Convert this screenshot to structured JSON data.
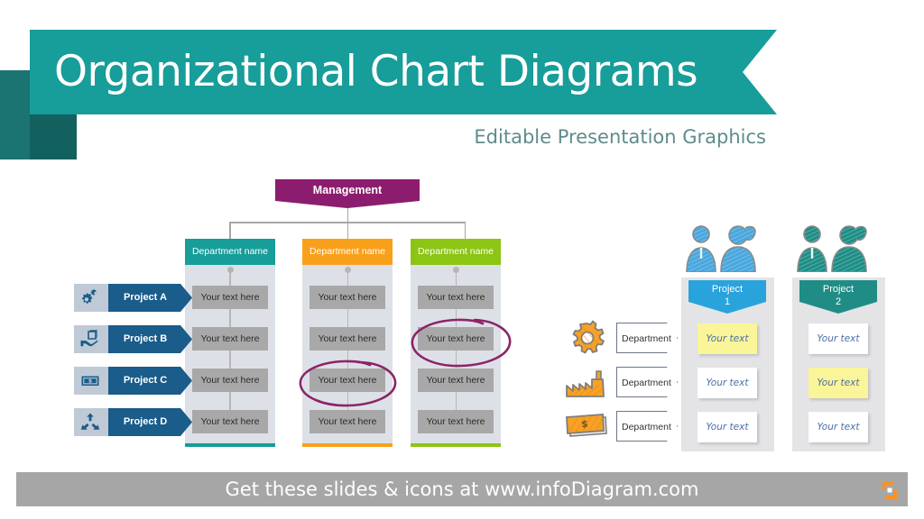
{
  "slide": {
    "title": "Organizational Chart Diagrams",
    "subtitle": "Editable Presentation Graphics"
  },
  "colors": {
    "banner_teal": "#179d9a",
    "banner_fold_dark": "#12615e",
    "banner_fold_mid": "#1b7472",
    "subtitle_teal": "#5f8c8b",
    "management_purple": "#8c1d6e",
    "dept1_teal": "#179d9a",
    "dept2_orange": "#f9a01b",
    "dept3_green": "#8cc514",
    "project_pill_blue": "#1a5c8a",
    "project_icon_bg": "#bfcad6",
    "column_bg": "#dde1e7",
    "cell_gray": "#a8a8a8",
    "connector_gray": "#a6a6a6",
    "annotation_purple": "#8c2468",
    "project1_blue": "#29a3dc",
    "project2_teal": "#1f8d85",
    "sketch_orange": "#f7a127",
    "sketch_outline": "#6b7687",
    "sketch_text_blue": "#4a6fa5",
    "highlight_yellow": "#fbf59a",
    "footer_gray": "#a6a6a6",
    "logo_orange": "#f79324"
  },
  "org_chart": {
    "management": {
      "label": "Management"
    },
    "departments": [
      {
        "header": "Department name",
        "color": "#179d9a",
        "project_rows": [
          "Your text here",
          "Your text here",
          "Your text here",
          "Your text here"
        ]
      },
      {
        "header": "Department name",
        "color": "#f9a01b",
        "project_rows": [
          "Your text here",
          "Your text here",
          "Your text here",
          "Your text here"
        ]
      },
      {
        "header": "Department name",
        "color": "#8cc514",
        "project_rows": [
          "Your text here",
          "Your text here",
          "Your text here",
          "Your text here"
        ]
      }
    ],
    "projects": [
      {
        "label": "Project A",
        "icon": "gears-icon"
      },
      {
        "label": "Project B",
        "icon": "hand-holding-box-icon"
      },
      {
        "label": "Project C",
        "icon": "money-bill-icon"
      },
      {
        "label": "Project D",
        "icon": "arrows-expand-icon"
      }
    ],
    "annotations": [
      {
        "name": "highlight-ellipse-dept2-row3",
        "target": "department 2, row 3"
      },
      {
        "name": "highlight-ellipse-dept3-row2",
        "target": "department 3, row 2"
      }
    ]
  },
  "matrix": {
    "row_departments": [
      {
        "label": "Department",
        "icon": "sketch-gear-icon"
      },
      {
        "label": "Department",
        "icon": "sketch-factory-icon"
      },
      {
        "label": "Department",
        "icon": "sketch-money-icon"
      }
    ],
    "project_columns": [
      {
        "name_line1": "Project",
        "name_line2": "1",
        "color": "#29a3dc",
        "people_icon": "team-people-blue-icon",
        "cells": [
          {
            "text": "Your text",
            "highlighted": true
          },
          {
            "text": "Your text",
            "highlighted": false
          },
          {
            "text": "Your text",
            "highlighted": false
          }
        ]
      },
      {
        "name_line1": "Project",
        "name_line2": "2",
        "color": "#1f8d85",
        "people_icon": "team-people-teal-icon",
        "cells": [
          {
            "text": "Your text",
            "highlighted": false
          },
          {
            "text": "Your text",
            "highlighted": true
          },
          {
            "text": "Your text",
            "highlighted": false
          }
        ]
      }
    ]
  },
  "footer": {
    "text": "Get these slides & icons at www.infoDiagram.com",
    "logo": "infodiagram-logo"
  }
}
